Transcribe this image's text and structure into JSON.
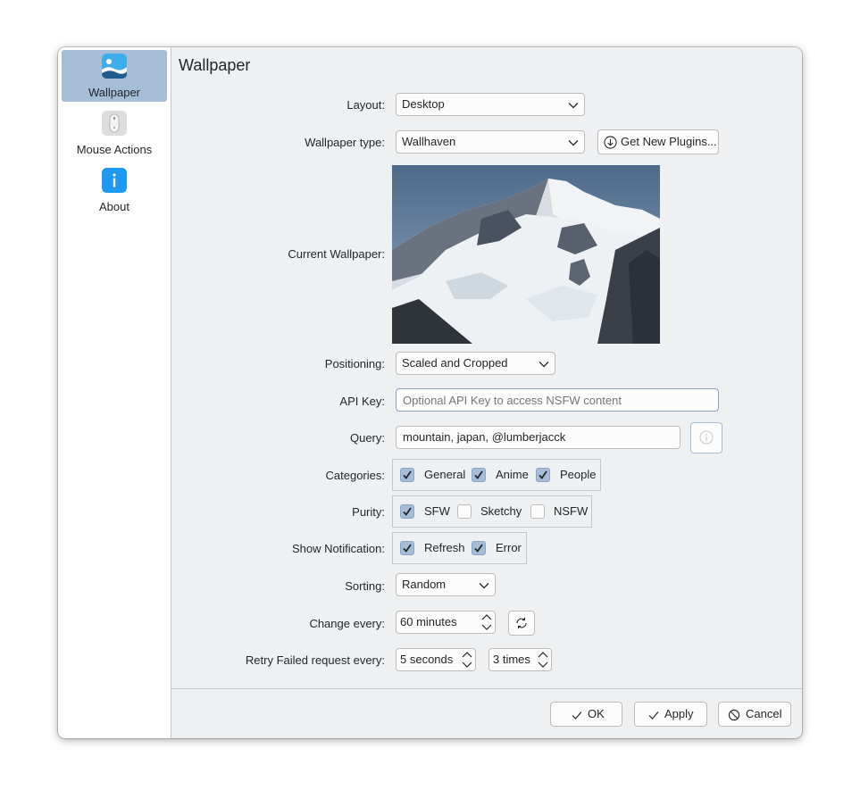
{
  "sidebar": {
    "items": [
      {
        "label": "Wallpaper",
        "icon": "wallpaper-image-icon",
        "active": true
      },
      {
        "label": "Mouse Actions",
        "icon": "mouse-icon",
        "active": false
      },
      {
        "label": "About",
        "icon": "info-icon",
        "active": false
      }
    ]
  },
  "page": {
    "title": "Wallpaper"
  },
  "form": {
    "layout": {
      "label": "Layout:",
      "value": "Desktop"
    },
    "wallpaper_type": {
      "label": "Wallpaper type:",
      "value": "Wallhaven",
      "plugins_button": "Get New Plugins..."
    },
    "current_wallpaper": {
      "label": "Current Wallpaper:"
    },
    "positioning": {
      "label": "Positioning:",
      "value": "Scaled and Cropped"
    },
    "api_key": {
      "label": "API Key:",
      "value": "",
      "placeholder": "Optional API Key to access NSFW content"
    },
    "query": {
      "label": "Query:",
      "value": "mountain, japan, @lumberjacck"
    },
    "categories": {
      "label": "Categories:",
      "options": [
        {
          "label": "General",
          "checked": true
        },
        {
          "label": "Anime",
          "checked": true
        },
        {
          "label": "People",
          "checked": true
        }
      ]
    },
    "purity": {
      "label": "Purity:",
      "options": [
        {
          "label": "SFW",
          "checked": true
        },
        {
          "label": "Sketchy",
          "checked": false
        },
        {
          "label": "NSFW",
          "checked": false
        }
      ]
    },
    "show_notification": {
      "label": "Show Notification:",
      "options": [
        {
          "label": "Refresh",
          "checked": true
        },
        {
          "label": "Error",
          "checked": true
        }
      ]
    },
    "sorting": {
      "label": "Sorting:",
      "value": "Random"
    },
    "change_every": {
      "label": "Change every:",
      "value": "60 minutes"
    },
    "retry": {
      "label": "Retry Failed request every:",
      "interval": "5 seconds",
      "times": "3 times"
    }
  },
  "footer": {
    "ok": "OK",
    "apply": "Apply",
    "cancel": "Cancel"
  },
  "colors": {
    "accent": "#a5bdd6",
    "window_bg": "#eff0f1",
    "info_blue": "#1d99f3"
  }
}
